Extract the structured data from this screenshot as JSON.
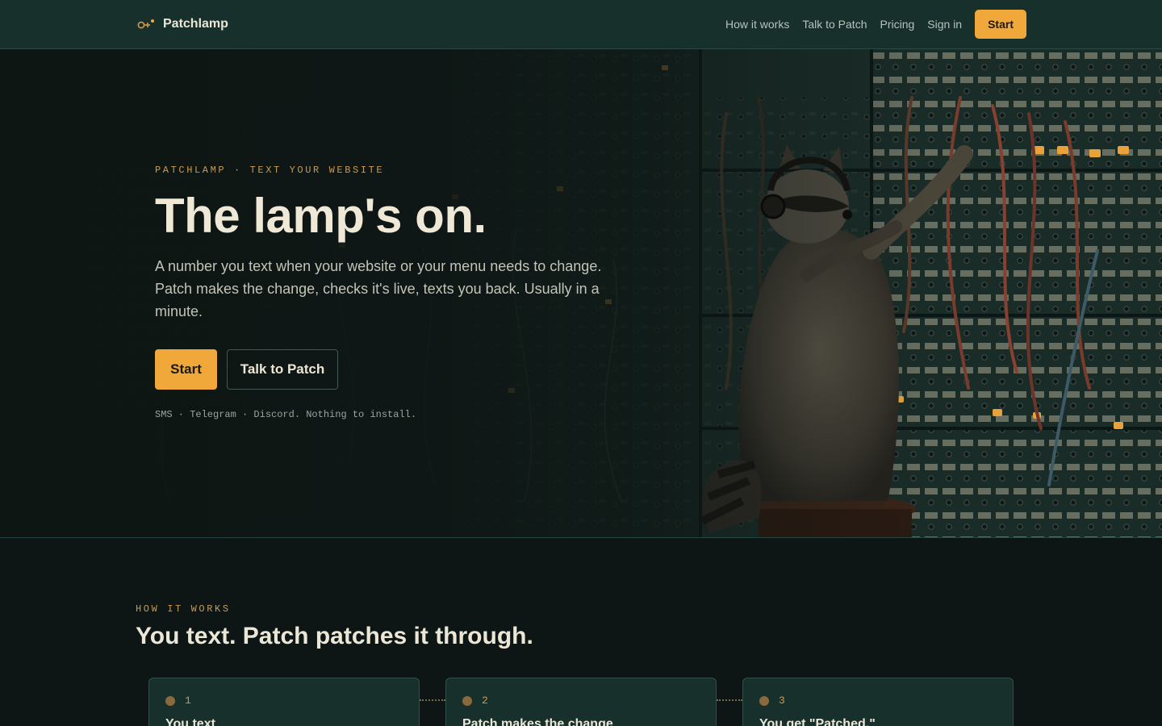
{
  "nav": {
    "brand": "Patchlamp",
    "links": [
      "How it works",
      "Talk to Patch",
      "Pricing",
      "Sign in"
    ],
    "start_label": "Start"
  },
  "hero": {
    "eyebrow": "PATCHLAMP · TEXT YOUR WEBSITE",
    "title": "The lamp's on.",
    "subtitle": "A number you text when your website or your menu needs to change. Patch makes the change, checks it's live, texts you back. Usually in a minute.",
    "primary_label": "Start",
    "secondary_label": "Talk to Patch",
    "channels": "SMS · Telegram · Discord. Nothing to install."
  },
  "how": {
    "eyebrow": "HOW IT WORKS",
    "title": "You text. Patch patches it through.",
    "steps": [
      {
        "num": "1",
        "title": "You text"
      },
      {
        "num": "2",
        "title": "Patch makes the change"
      },
      {
        "num": "3",
        "title": "You get \"Patched.\""
      }
    ]
  },
  "colors": {
    "accent": "#f0a83a",
    "nav_bg": "#17302c",
    "page_bg": "#0d1614",
    "eyebrow": "#c99a52"
  },
  "icons": {
    "brand": "patch-plug-icon"
  }
}
